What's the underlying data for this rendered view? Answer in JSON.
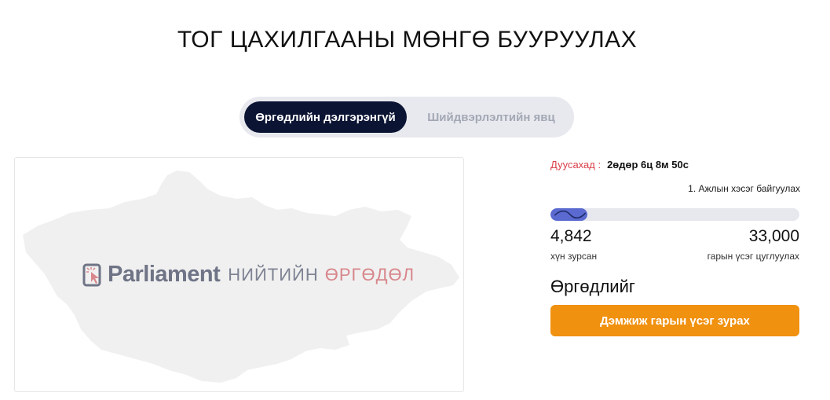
{
  "page": {
    "title": "ТОГ ЦАХИЛГААНЫ МӨНГӨ БУУРУУЛАХ"
  },
  "tabs": [
    {
      "label": "Өргөдлийн дэлгэрэнгүй",
      "active": true
    },
    {
      "label": "Шийдвэрлэлтийн явц",
      "active": false
    }
  ],
  "banner": {
    "logo_word": "Parliament",
    "logo_subtitle_1": "НИЙТИЙН",
    "logo_subtitle_2": "ӨРГӨДӨЛ",
    "colors": {
      "map": "#f0f0f0",
      "logo_gray": "#6f7486",
      "logo_pink": "#d8878c"
    }
  },
  "status": {
    "deadline_label": "Дуусахад :",
    "deadline_value": "2өдөр 6ц 8м 50с",
    "stage": "1. Ажлын хэсэг байгуулах"
  },
  "progress": {
    "signed": "4,842",
    "signed_label": "хүн зурсан",
    "goal": "33,000",
    "goal_label": "гарын үсэг цуглуулах",
    "fraction": 0.1467
  },
  "signing": {
    "heading": "Өргөдлийг",
    "button_label": "Дэмжиж гарын үсэг зурах"
  },
  "colors": {
    "accent_orange": "#f0910f",
    "tab_active_bg": "#0b1433",
    "deadline_red": "#d9404a",
    "progress_blue": "#5b6ad0"
  }
}
